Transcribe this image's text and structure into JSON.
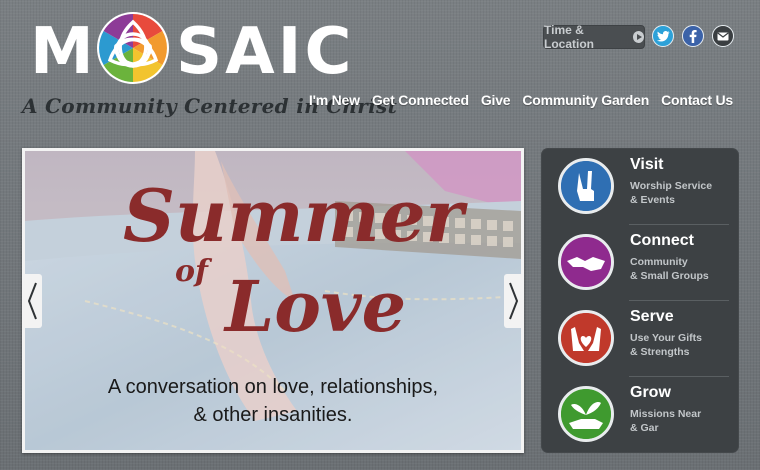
{
  "brand": {
    "word_left": "M",
    "word_right": "SAIC",
    "tagline": "A Community Centered in Christ"
  },
  "header": {
    "time_location_label": "Time & Location",
    "social": [
      {
        "name": "twitter-icon"
      },
      {
        "name": "facebook-icon"
      },
      {
        "name": "email-icon"
      }
    ]
  },
  "nav": {
    "items": [
      {
        "label": "I'm New"
      },
      {
        "label": "Get Connected"
      },
      {
        "label": "Give"
      },
      {
        "label": "Community Garden"
      },
      {
        "label": "Contact Us"
      }
    ]
  },
  "hero": {
    "headline_line1": "Summer",
    "headline_line2": "of",
    "headline_line3": "Love",
    "caption_line1": "A conversation on love, relationships,",
    "caption_line2": "& other insanities."
  },
  "sidebar": {
    "items": [
      {
        "title": "Visit",
        "sub1": "Worship Service",
        "sub2": "& Events",
        "icon": "peace-hand-icon",
        "color": "#2f6fb3"
      },
      {
        "title": "Connect",
        "sub1": "Community",
        "sub2": "& Small Groups",
        "icon": "handshake-icon",
        "color": "#8f2a8e"
      },
      {
        "title": "Serve",
        "sub1": "Use Your Gifts",
        "sub2": "& Strengths",
        "icon": "open-hands-heart-icon",
        "color": "#c0392b"
      },
      {
        "title": "Grow",
        "sub1": "Missions Near",
        "sub2": "& Gar",
        "icon": "sprout-hand-icon",
        "color": "#3f9a2f"
      }
    ]
  },
  "colors": {
    "background": "#6f7478",
    "panel": "#3d4144",
    "headline": "#8a2b2b"
  }
}
